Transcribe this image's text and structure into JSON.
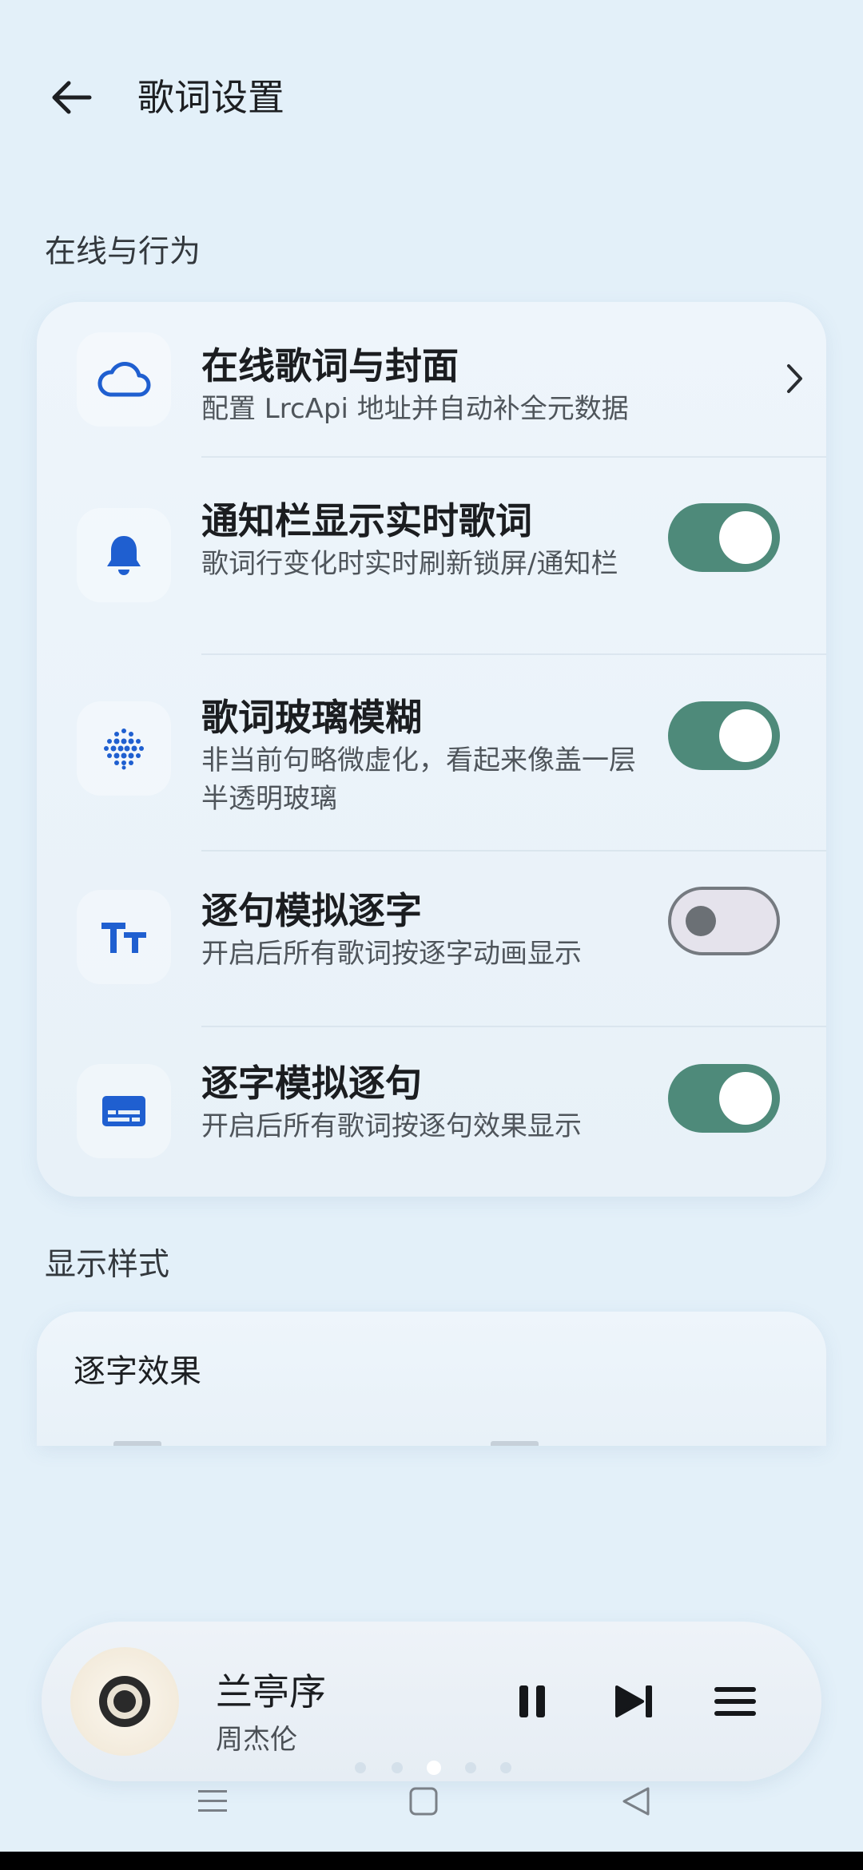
{
  "header": {
    "title": "歌词设置"
  },
  "sections": {
    "behavior": "在线与行为",
    "style": "显示样式"
  },
  "rows": [
    {
      "title": "在线歌词与封面",
      "subtitle": "配置 LrcApi 地址并自动补全元数据",
      "icon": "cloud-icon",
      "control": "chevron"
    },
    {
      "title": "通知栏显示实时歌词",
      "subtitle": "歌词行变化时实时刷新锁屏/通知栏",
      "icon": "bell-icon",
      "control": "toggle",
      "checked": true
    },
    {
      "title": "歌词玻璃模糊",
      "subtitle": "非当前句略微虚化，看起来像盖一层半透明玻璃",
      "icon": "blur-dots-icon",
      "control": "toggle",
      "checked": true
    },
    {
      "title": "逐句模拟逐字",
      "subtitle": "开启后所有歌词按逐字动画显示",
      "icon": "text-size-icon",
      "control": "toggle",
      "checked": false
    },
    {
      "title": "逐字模拟逐句",
      "subtitle": "开启后所有歌词按逐句效果显示",
      "icon": "subtitles-icon",
      "control": "toggle",
      "checked": true
    }
  ],
  "style_card": {
    "title": "逐字效果"
  },
  "player": {
    "song": "兰亭序",
    "artist": "周杰伦",
    "page_dots": 5,
    "active_dot": 3
  },
  "colors": {
    "background": "#e3f0f9",
    "accent_icon": "#1f5fd0",
    "toggle_on": "#4e8a7a",
    "toggle_off": "#e5e3ec"
  }
}
